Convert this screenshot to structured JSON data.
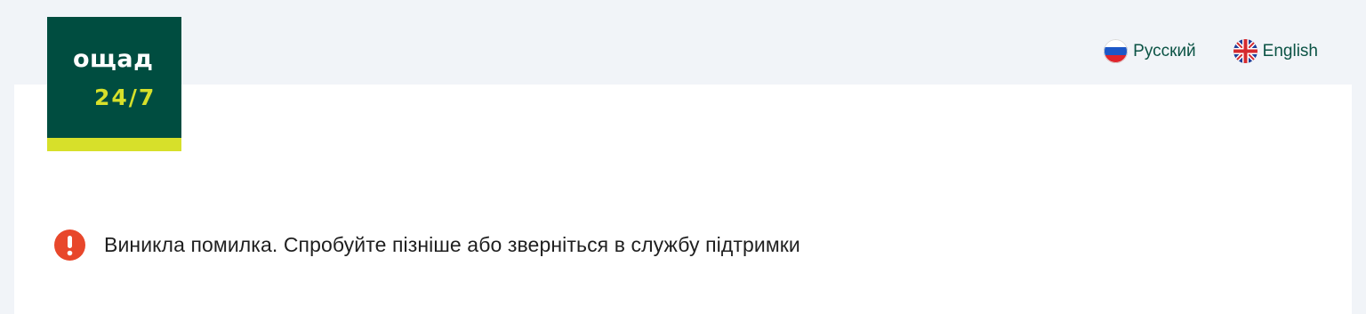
{
  "brand": {
    "logo_word": "ощад",
    "logo_number": "24/7",
    "colors": {
      "primary": "#004d40",
      "accent": "#d7e02a",
      "background": "#f1f4f8"
    }
  },
  "languages": [
    {
      "label": "Русский",
      "icon": "russia-flag-icon"
    },
    {
      "label": "English",
      "icon": "uk-flag-icon"
    }
  ],
  "error": {
    "icon": "exclamation-icon",
    "icon_color": "#e8472b",
    "message": "Виникла помилка. Спробуйте пізніше або зверніться в службу підтримки"
  }
}
